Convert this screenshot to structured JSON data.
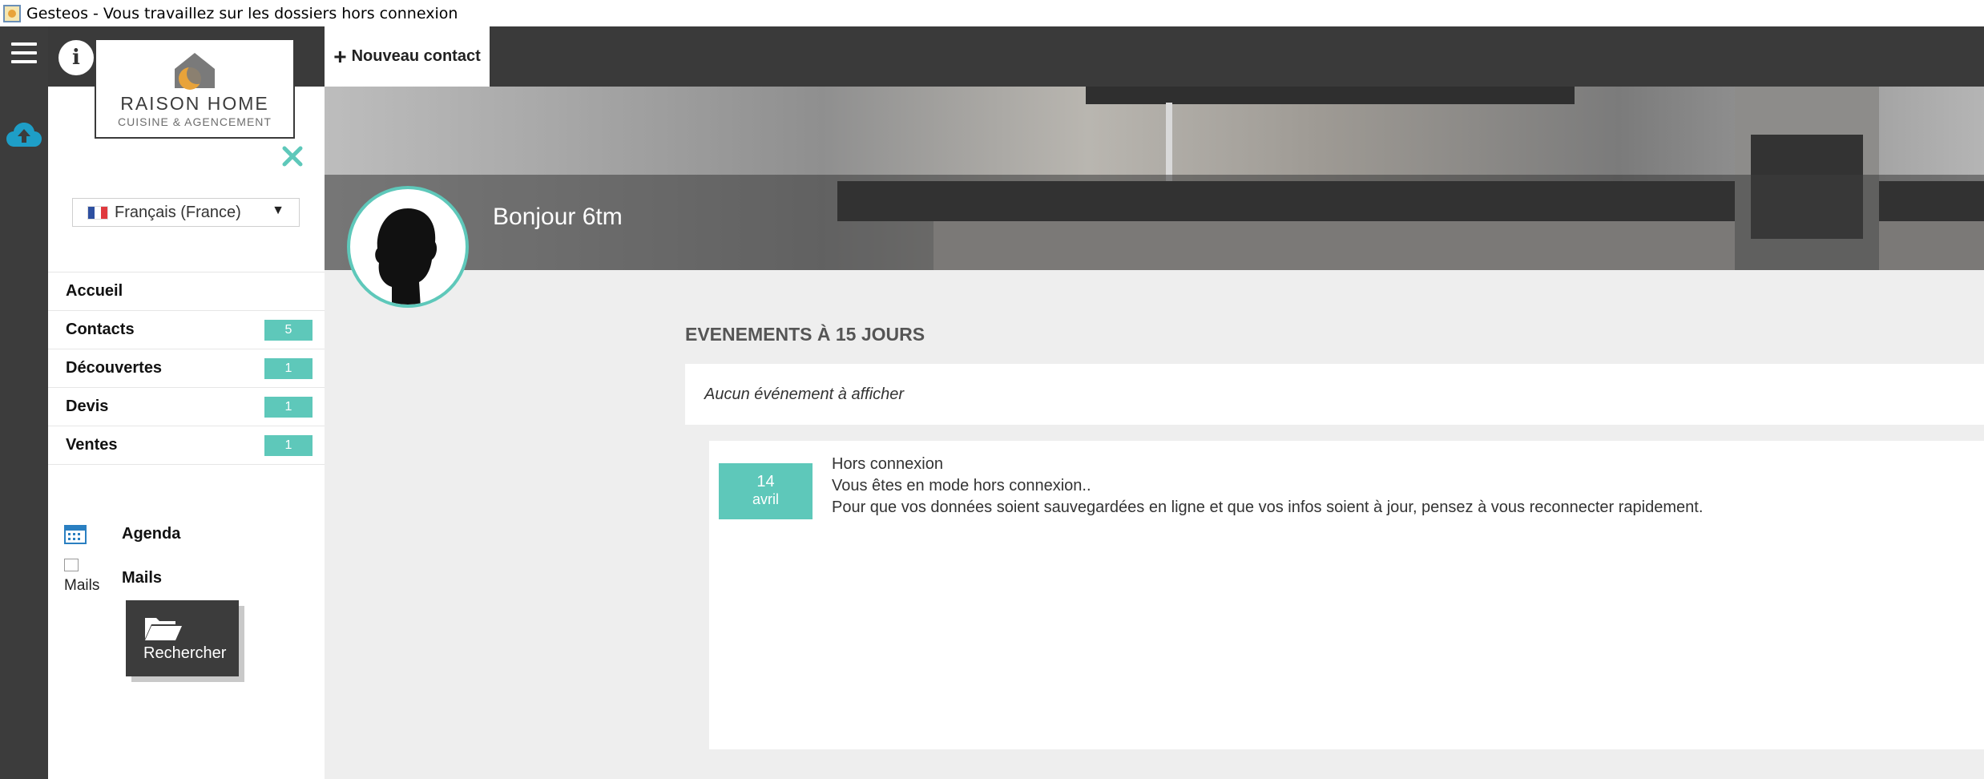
{
  "window": {
    "title": "Gesteos - Vous travaillez sur les dossiers hors connexion"
  },
  "header": {
    "new_contact_label": "Nouveau contact"
  },
  "logo": {
    "brand": "RAISON HOME",
    "subtitle": "CUISINE & AGENCEMENT"
  },
  "sidebar": {
    "language": "Français (France)",
    "items": [
      {
        "label": "Accueil",
        "count": ""
      },
      {
        "label": "Contacts",
        "count": "5"
      },
      {
        "label": "Découvertes",
        "count": "1"
      },
      {
        "label": "Devis",
        "count": "1"
      },
      {
        "label": "Ventes",
        "count": "1"
      }
    ],
    "tools": {
      "agenda_label": "Agenda",
      "mails_alt": "Mails",
      "mails_label": "Mails",
      "search_label": "Rechercher"
    }
  },
  "main": {
    "greeting": "Bonjour 6tm",
    "events": {
      "title": "EVENEMENTS À 15 JOURS",
      "empty_message": "Aucun événement à afficher"
    },
    "notice": {
      "day": "14",
      "month": "avril",
      "title": "Hors connexion",
      "line1": "Vous êtes en mode hors connexion..",
      "line2": "Pour que vos données soient sauvegardées en ligne et que vos infos soient à jour, pensez à vous reconnecter rapidement."
    }
  },
  "colors": {
    "accent": "#5ec8ba",
    "dark": "#3a3a3a",
    "cloud": "#1e9ec7"
  }
}
